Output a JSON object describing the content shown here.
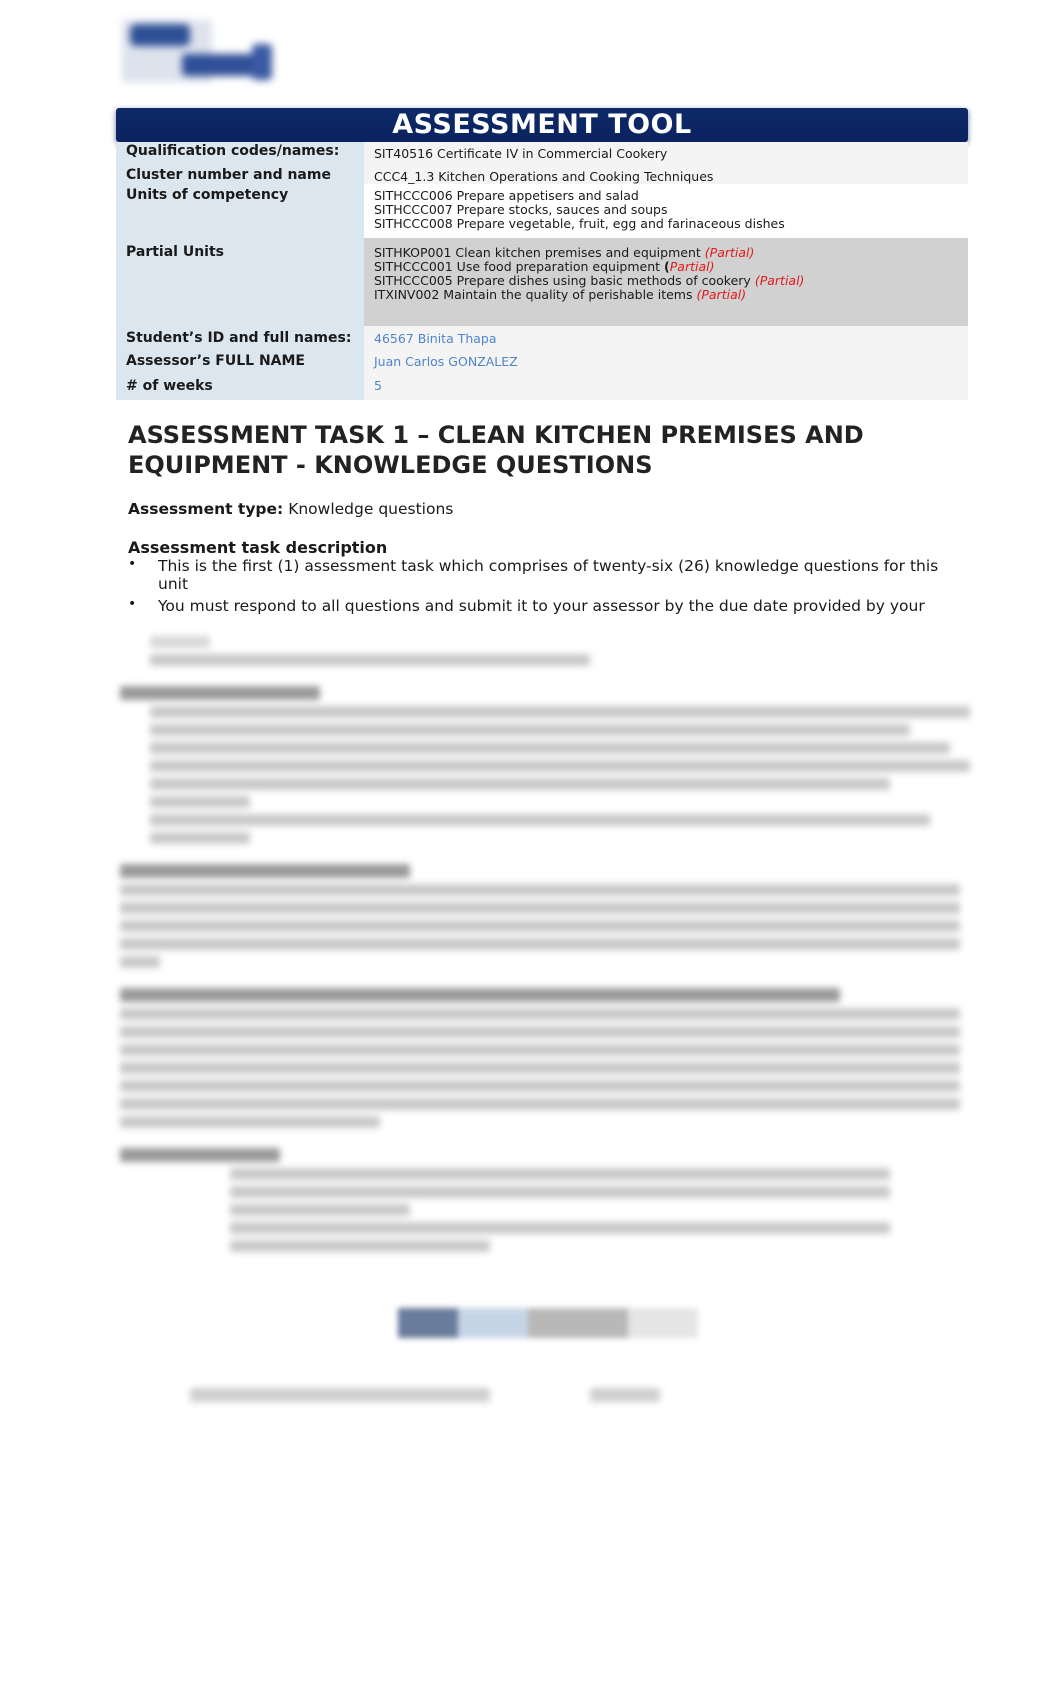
{
  "header": {
    "logo_icon": "institution-logo-icon",
    "banner_title": "ASSESSMENT TOOL"
  },
  "details": [
    {
      "label": "Qualification codes/names:",
      "values": [
        "SIT40516 Certificate IV in Commercial Cookery"
      ]
    },
    {
      "label": "Cluster number and name",
      "values": [
        "CCC4_1.3 Kitchen Operations and Cooking Techniques"
      ]
    },
    {
      "label": "Units of competency",
      "values": [
        "SITHCCC006 Prepare appetisers and salad",
        "SITHCCC007 Prepare stocks, sauces and soups",
        "SITHCCC008 Prepare vegetable, fruit, egg and farinaceous dishes"
      ]
    },
    {
      "label": "Partial Units",
      "values": [
        {
          "text": "SITHKOP001 Clean kitchen premises and equipment",
          "tag": "Partial"
        },
        {
          "text": "SITHCCC001 Use food preparation equipment",
          "tag": "Partial"
        },
        {
          "text": "SITHCCC005 Prepare dishes using basic methods of cookery",
          "tag": "Partial"
        },
        {
          "text": "ITXINV002 Maintain the quality of perishable items",
          "tag": "Partial"
        }
      ]
    },
    {
      "label": "Student’s ID and full names:",
      "values": [
        "46567 Binita Thapa"
      ]
    },
    {
      "label": "Assessor’s FULL NAME",
      "values": [
        "Juan Carlos GONZALEZ"
      ]
    },
    {
      "label": "# of weeks",
      "values": [
        "5"
      ]
    }
  ],
  "task": {
    "title_line1": "ASSESSMENT TASK 1 – CLEAN KITCHEN PREMISES AND",
    "title_line2": "EQUIPMENT - KNOWLEDGE QUESTIONS",
    "type_label": "Assessment type:",
    "type_value": "Knowledge questions",
    "description_heading": "Assessment task description",
    "bullets": [
      "This is the first (1) assessment task which comprises of twenty-six (26) knowledge questions for this unit",
      "You must respond to all questions and submit it to your assessor by the due date provided by your"
    ]
  },
  "colors": {
    "banner": "#0a2260",
    "label_bg": "#dce6ef",
    "partial_red": "#e01b1b",
    "student_value_blue": "#4f86c9",
    "partial_units_bg": "#d1d1d1"
  }
}
